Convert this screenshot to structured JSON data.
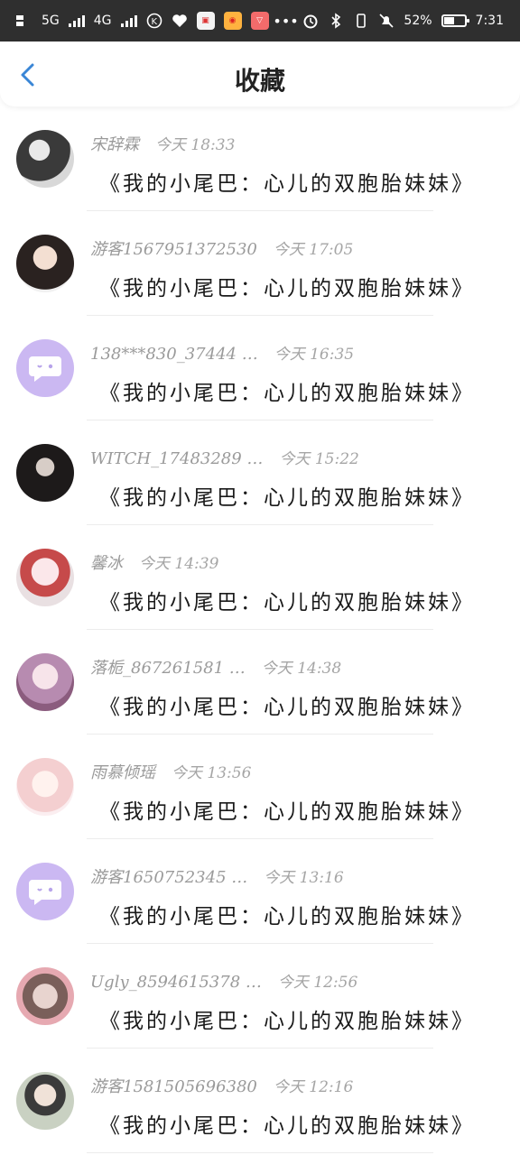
{
  "status_bar": {
    "network_left": "5G",
    "network_mid": "4G",
    "battery_percent": "52%",
    "battery_level": 0.52,
    "time": "7:31",
    "icons": [
      "hd-icon",
      "signal-icon",
      "k-icon",
      "heart-icon",
      "app-icon",
      "weibo-icon",
      "gift-icon",
      "more-icon",
      "alarm-icon",
      "bluetooth-icon",
      "vibrate-icon",
      "mute-icon",
      "battery-icon"
    ]
  },
  "header": {
    "title": "收藏",
    "back_icon": "chevron-left-icon",
    "accent": "#3a86d6"
  },
  "items": [
    {
      "name": "宋辞霖",
      "time": "今天 18:33",
      "title": "《我的小尾巴：心儿的双胞胎妹妹》",
      "avatar": "av-dark"
    },
    {
      "name": "游客1567951372530",
      "time": "今天 17:05",
      "title": "《我的小尾巴：心儿的双胞胎妹妹》",
      "avatar": "av-woman"
    },
    {
      "name": "138***830_37444 …",
      "time": "今天 16:35",
      "title": "《我的小尾巴：心儿的双胞胎妹妹》",
      "avatar": "av-purple"
    },
    {
      "name": "WITCH_17483289 …",
      "time": "今天 15:22",
      "title": "《我的小尾巴：心儿的双胞胎妹妹》",
      "avatar": "av-goth"
    },
    {
      "name": "馨冰",
      "time": "今天 14:39",
      "title": "《我的小尾巴：心儿的双胞胎妹妹》",
      "avatar": "av-anime1"
    },
    {
      "name": "落栀_867261581 …",
      "time": "今天 14:38",
      "title": "《我的小尾巴：心儿的双胞胎妹妹》",
      "avatar": "av-anime2"
    },
    {
      "name": "雨慕倾瑶",
      "time": "今天 13:56",
      "title": "《我的小尾巴：心儿的双胞胎妹妹》",
      "avatar": "av-anime3"
    },
    {
      "name": "游客1650752345 …",
      "time": "今天 13:16",
      "title": "《我的小尾巴：心儿的双胞胎妹妹》",
      "avatar": "av-purple"
    },
    {
      "name": "Ugly_8594615378 …",
      "time": "今天 12:56",
      "title": "《我的小尾巴：心儿的双胞胎妹妹》",
      "avatar": "av-photo1"
    },
    {
      "name": "游客1581505696380",
      "time": "今天 12:16",
      "title": "《我的小尾巴：心儿的双胞胎妹妹》",
      "avatar": "av-photo2"
    }
  ]
}
